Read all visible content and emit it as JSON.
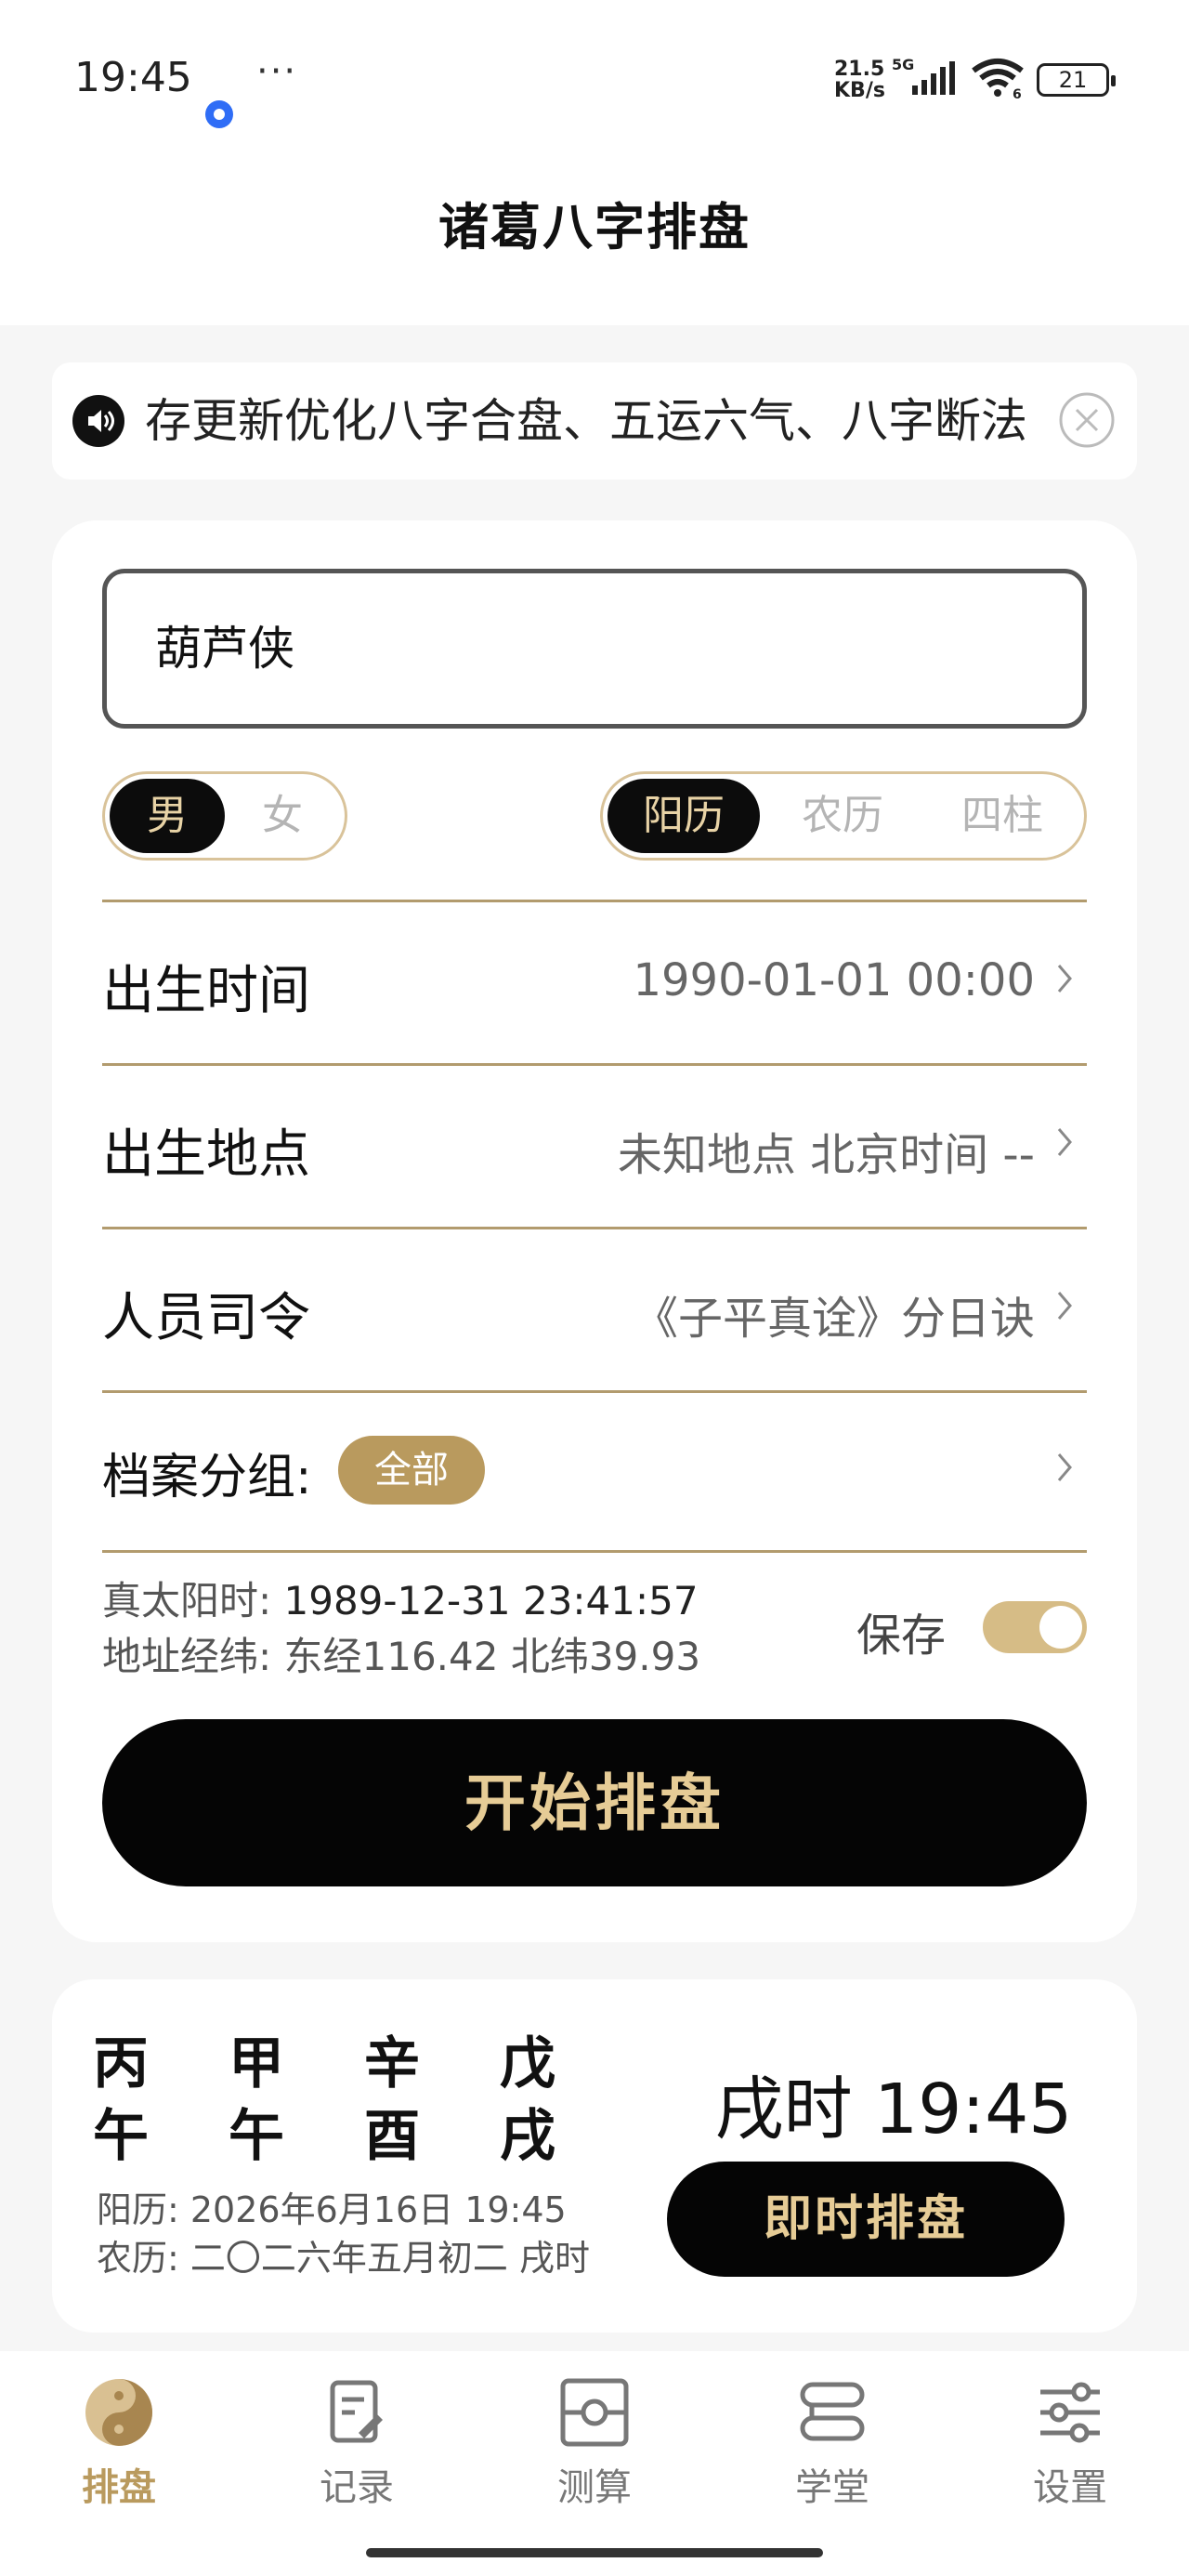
{
  "status_bar": {
    "time": "19:45",
    "more": "···",
    "net_speed_top": "21.5",
    "net_speed_bottom": "KB/s",
    "network_type": "5G",
    "wifi_badge": "6",
    "battery": "21"
  },
  "header": {
    "title": "诸葛八字排盘"
  },
  "notice": {
    "text": "存更新优化八字合盘、五运六气、八字断法"
  },
  "form": {
    "name_value": "葫芦侠",
    "gender": {
      "options": [
        "男",
        "女"
      ],
      "selected": "男"
    },
    "calendar": {
      "options": [
        "阳历",
        "农历",
        "四柱"
      ],
      "selected": "阳历"
    },
    "rows": {
      "birth_time": {
        "label": "出生时间",
        "value": "1990-01-01 00:00"
      },
      "birth_place": {
        "label": "出生地点",
        "value": "未知地点 北京时间 --"
      },
      "ruling": {
        "label": "人员司令",
        "value": "《子平真诠》分日诀"
      },
      "group": {
        "label": "档案分组:",
        "badge": "全部"
      }
    },
    "solar_time_label": "真太阳时:",
    "solar_time_value": "1989-12-31 23:41:57",
    "coords_label": "地址经纬:",
    "coords_value": "东经116.42 北纬39.93",
    "save_label": "保存",
    "save_on": true,
    "start_button": "开始排盘"
  },
  "instant": {
    "pillars": [
      {
        "stem": "丙",
        "branch": "午"
      },
      {
        "stem": "甲",
        "branch": "午"
      },
      {
        "stem": "辛",
        "branch": "酉"
      },
      {
        "stem": "戊",
        "branch": "戌"
      }
    ],
    "solar_date": "阳历: 2026年6月16日 19:45",
    "lunar_date": "农历: 二〇二六年五月初二 戌时",
    "clock": "戌时 19:45",
    "button": "即时排盘"
  },
  "nav": {
    "items": [
      {
        "label": "排盘",
        "icon": "yin-yang-icon",
        "active": true
      },
      {
        "label": "记录",
        "icon": "edit-note-icon",
        "active": false
      },
      {
        "label": "测算",
        "icon": "compass-icon",
        "active": false
      },
      {
        "label": "学堂",
        "icon": "scroll-icon",
        "active": false
      },
      {
        "label": "设置",
        "icon": "sliders-icon",
        "active": false
      }
    ]
  },
  "colors": {
    "gold": "#b99a5e",
    "gold_light": "#e6cc96",
    "black": "#050505",
    "divider": "#b29b6e"
  }
}
